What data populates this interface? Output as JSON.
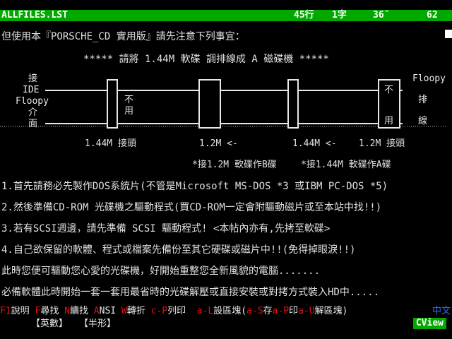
{
  "titlebar": {
    "filename": "ALLFILES.LST",
    "row": "45行",
    "col": "1字",
    "pct": "36˜",
    "total": "62"
  },
  "content": {
    "lines": [
      "但使用本『PORSCHE_CD 實用版』請先注意下列事宜：",
      "***** 請將 1.44M 軟碟 調排線成 A 磁碟機 *****",
      "1.首先請務必先製作DOS系統片(不管是Microsoft MS-DOS *3 或IBM PC-DOS *5)",
      "2.然後準備CD-ROM 光碟機之驅動程式(買CD-ROM一定會附驅動磁片或至本站中找!!)",
      "3.若有SCSI週邊，請先準備 SCSI 驅動程式! <本帖內亦有,先拷至軟碟>",
      "4.自己欲保留的軟體、程式或檔案先備份至其它硬碟或磁片中!!(免得掉眼淚!!)",
      "此時您便可驅動您心愛的光碟機，好開始重整您全新風貌的電腦.......",
      "必備軟體此時開始一套一套用最省時的光碟解壓或直接安裝或對拷方式裝入HD中....."
    ]
  },
  "diagram": {
    "left_label_1": "接",
    "left_label_2": "IDE",
    "left_label_3": "Floopy",
    "left_label_4": "介",
    "left_label_5": "面",
    "box1_a": "不",
    "box1_b": "用",
    "box4_a": "不",
    "box4_b": "用",
    "right_label_1": "Floopy",
    "right_label_2": "排",
    "right_label_3": "線",
    "lbl_a": "1.44M 接頭",
    "lbl_b": "1.2M <-",
    "lbl_c": "1.44M <-",
    "lbl_d": "1.2M 接頭",
    "lbl_e": "*接1.2M 軟碟作B碟",
    "lbl_f": "*接1.44M 軟碟作A碟"
  },
  "statusbar": {
    "k1": "F1",
    "t1": "說明 ",
    "k2": "F",
    "t2": "尋找 ",
    "k3": "N",
    "t3": "續找 ",
    "k4": "A",
    "t4": "NSI ",
    "k5": "W",
    "t5": "轉折 ",
    "k6": "c-P",
    "t6": "列印  ",
    "k7": "a-L",
    "t7": "設區塊(",
    "k8": "a-S",
    "t8": "存",
    "k9": "a-P",
    "t9": "印",
    "k10": "a-U",
    "t10": "解區塊) ",
    "chinese": "中文"
  },
  "inputbar": {
    "mode1": "【英數】",
    "mode2": "【半形】",
    "app": "CView"
  },
  "colors": {
    "titlebar_bg": "#00a800",
    "key_red": "#e01010",
    "chinese_blue": "#2a6cff"
  }
}
